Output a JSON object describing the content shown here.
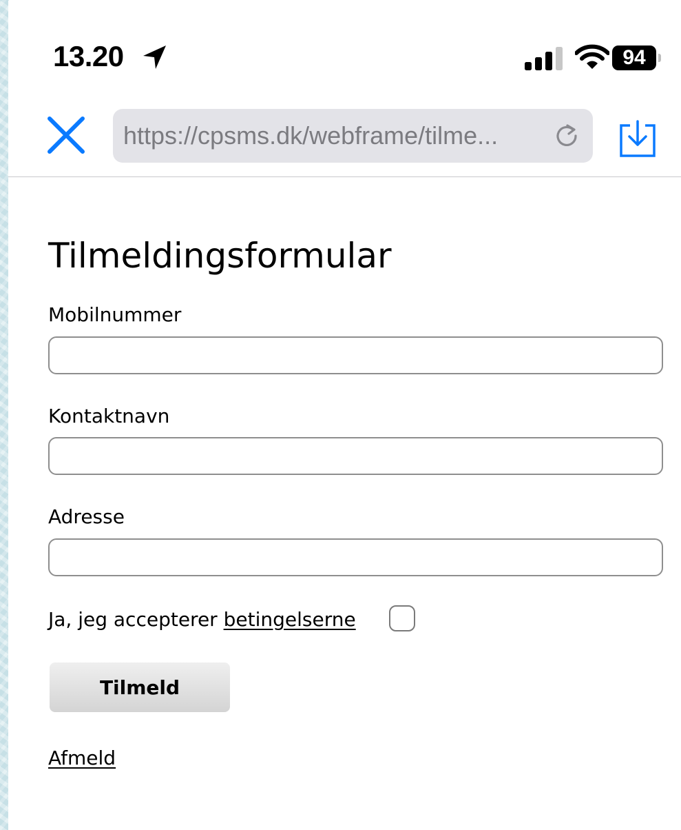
{
  "status_bar": {
    "time": "13.20",
    "battery_level": "94",
    "icons": [
      "location-arrow-icon",
      "cellular-signal-icon",
      "wifi-icon",
      "battery-icon"
    ]
  },
  "browser": {
    "url": "https://cpsms.dk/webframe/tilme...",
    "accent_color": "#0a7aff",
    "icons": [
      "close-icon",
      "reload-icon",
      "download-icon"
    ]
  },
  "form": {
    "title": "Tilmeldingsformular",
    "fields": [
      {
        "label": "Mobilnummer",
        "value": ""
      },
      {
        "label": "Kontaktnavn",
        "value": ""
      },
      {
        "label": "Adresse",
        "value": ""
      }
    ],
    "consent_text": "Ja, jeg accepterer ",
    "consent_link": "betingelserne",
    "consent_checked": false,
    "submit_label": "Tilmeld",
    "unsubscribe_label": "Afmeld"
  }
}
